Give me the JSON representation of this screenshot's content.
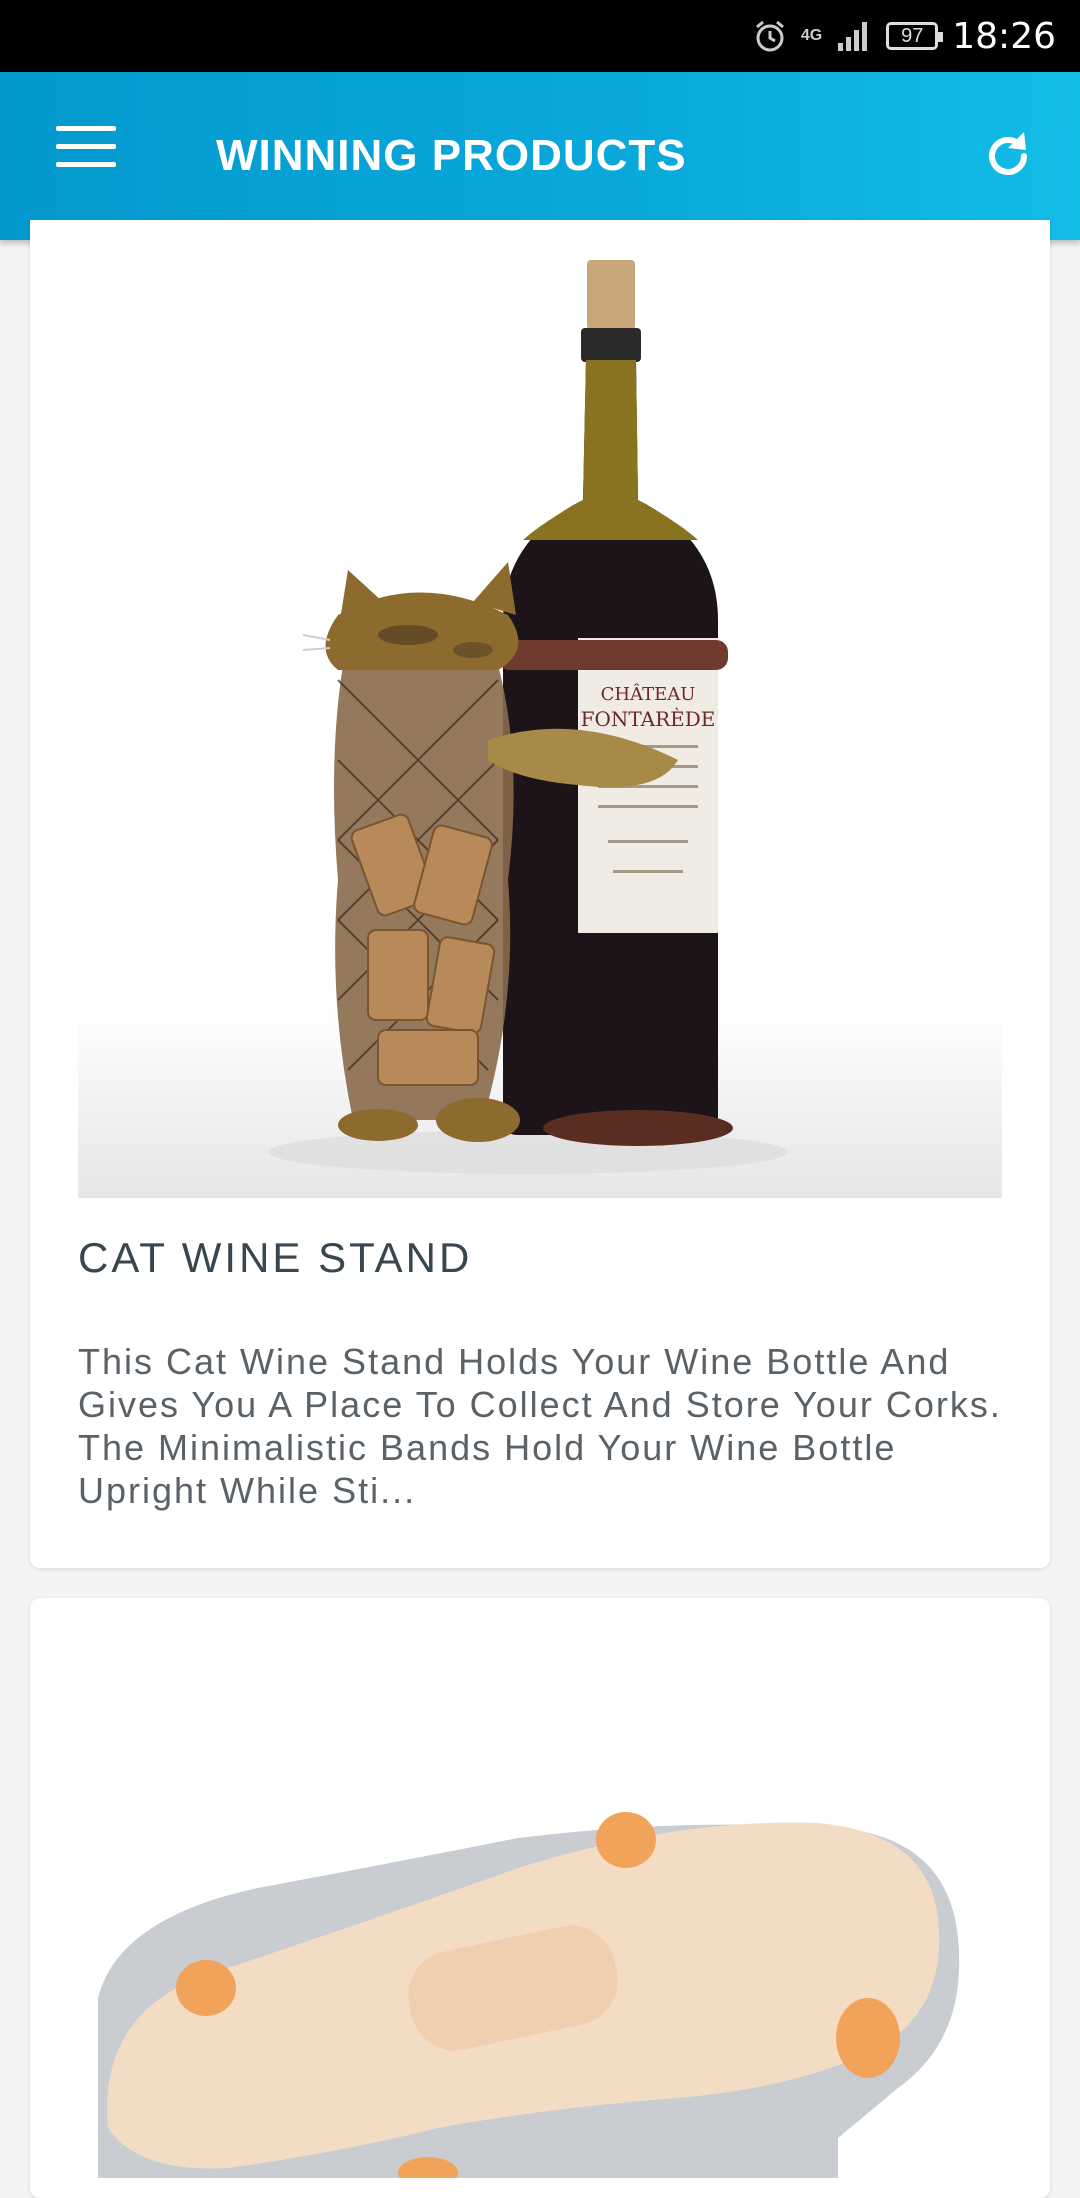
{
  "status_bar": {
    "network": "4G",
    "battery": "97",
    "time": "18:26"
  },
  "app_bar": {
    "title": "WINNING PRODUCTS",
    "menu_icon": "hamburger-menu-icon",
    "refresh_icon": "refresh-icon"
  },
  "products": [
    {
      "title": "CAT WINE STAND",
      "description": "This Cat Wine Stand Holds Your Wine Bottle And Gives You A Place To Collect And Store Your Corks. The Minimalistic Bands Hold Your Wine Bottle Upright While Sti..."
    }
  ],
  "colors": {
    "app_bar": "#0aa9db",
    "background": "#f4f4f4",
    "title_text": "#37474f"
  }
}
